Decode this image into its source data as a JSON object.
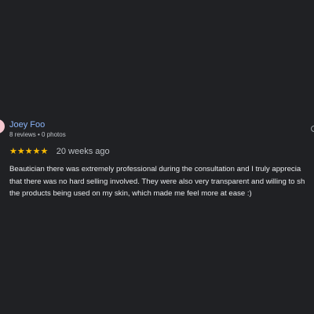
{
  "reviewer": {
    "name": "Joey Foo",
    "meta": "8 reviews • 0 photos"
  },
  "rating": {
    "stars": 5,
    "max_stars": 5,
    "star_glyphs": "★★★★★",
    "time": "20 weeks ago"
  },
  "review": {
    "lines": [
      "Beautician there was extremely professional during the consultation and I truly apprecia",
      "that there was no hard selling involved. They were also very transparent and willing to sh",
      "the products being used on my skin, which made me feel more at ease :)"
    ]
  },
  "colors": {
    "background": "#202124",
    "name": "#8ab4f8",
    "stars": "#fbbc04",
    "secondary_text": "#bdc1c6",
    "body_text": "#e8eaed",
    "avatar": "#f4c7cf"
  },
  "icons": {
    "more": "more-options-icon"
  }
}
